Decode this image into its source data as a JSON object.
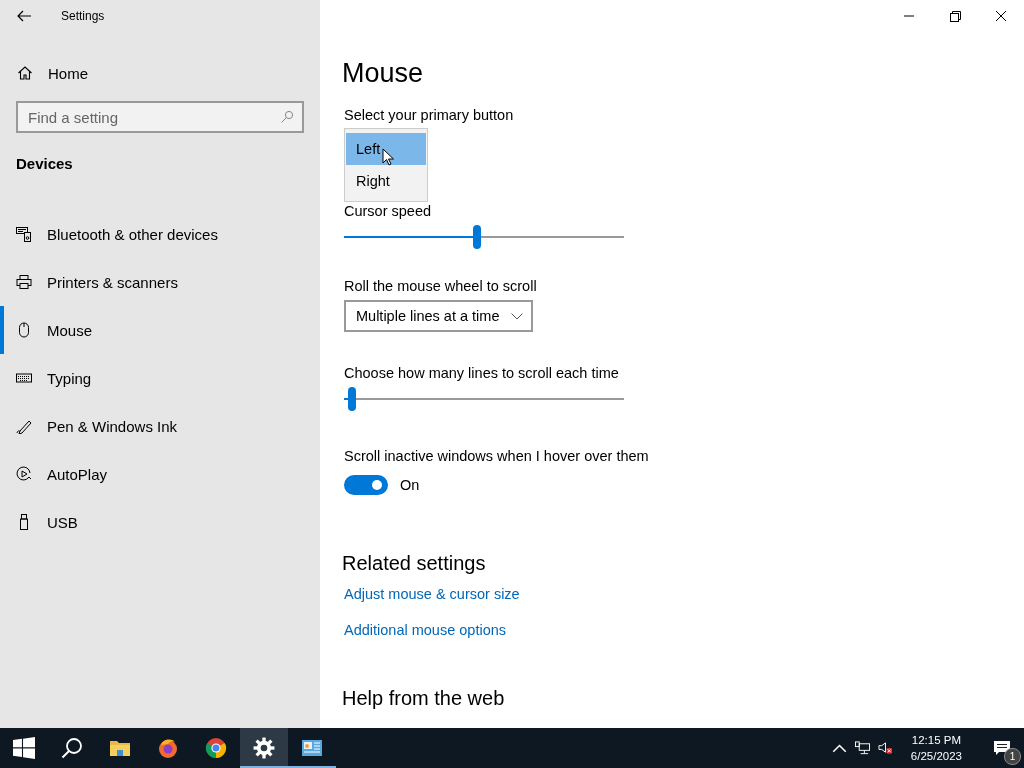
{
  "window": {
    "title": "Settings"
  },
  "sidebar": {
    "home": "Home",
    "search": {
      "placeholder": "Find a setting"
    },
    "section": "Devices",
    "items": [
      {
        "label": "Bluetooth & other devices",
        "kind": "devices",
        "selected": false
      },
      {
        "label": "Printers & scanners",
        "kind": "printer",
        "selected": false
      },
      {
        "label": "Mouse",
        "kind": "mouse",
        "selected": true
      },
      {
        "label": "Typing",
        "kind": "keyboard",
        "selected": false
      },
      {
        "label": "Pen & Windows Ink",
        "kind": "pen",
        "selected": false
      },
      {
        "label": "AutoPlay",
        "kind": "autoplay",
        "selected": false
      },
      {
        "label": "USB",
        "kind": "usb",
        "selected": false
      }
    ]
  },
  "page": {
    "title": "Mouse",
    "primary_button": {
      "label": "Select your primary button",
      "options": [
        {
          "label": "Left",
          "selected": true
        },
        {
          "label": "Right",
          "selected": false
        }
      ]
    },
    "cursor_speed": {
      "label": "Cursor speed",
      "level": 0.475
    },
    "wheel": {
      "label": "Roll the mouse wheel to scroll",
      "value": "Multiple lines at a time"
    },
    "lines": {
      "label": "Choose how many lines to scroll each time",
      "level": 0.03
    },
    "inactive": {
      "label": "Scroll inactive windows when I hover over them",
      "on": true,
      "state": "On"
    },
    "related": {
      "heading": "Related settings",
      "links": [
        "Adjust mouse & cursor size",
        "Additional mouse options"
      ]
    },
    "help": {
      "heading": "Help from the web"
    }
  },
  "taskbar": {
    "apps": [
      {
        "kind": "start",
        "selected": false,
        "running": false
      },
      {
        "kind": "search",
        "selected": false,
        "running": false
      },
      {
        "kind": "folder",
        "selected": false,
        "running": false
      },
      {
        "kind": "firefox",
        "selected": false,
        "running": false
      },
      {
        "kind": "chrome",
        "selected": false,
        "running": false
      },
      {
        "kind": "gear",
        "selected": true,
        "running": true
      },
      {
        "kind": "panel",
        "selected": false,
        "running": true
      }
    ],
    "time": "12:15 PM",
    "date": "6/25/2023",
    "notifications": "1"
  }
}
